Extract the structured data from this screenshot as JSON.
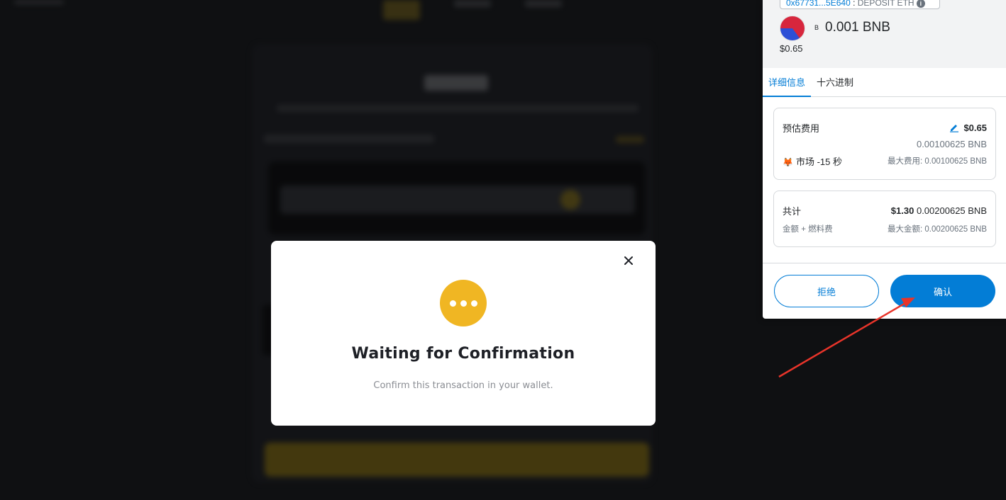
{
  "modal": {
    "title": "Waiting for Confirmation",
    "description": "Confirm this transaction in your wallet."
  },
  "wallet": {
    "origin": {
      "address": "0x67731...5E640",
      "separator": " : ",
      "label": "DEPOSIT ETH"
    },
    "token_symbol": "B",
    "amount": "0.001 BNB",
    "fiat": "$0.65",
    "tabs": [
      {
        "label": "详细信息",
        "active": true
      },
      {
        "label": "十六进制",
        "active": false
      }
    ],
    "fee": {
      "label": "预估费用",
      "fiat": "$0.65",
      "amount": "0.00100625 BNB",
      "speed": "市场",
      "time": "-15 秒",
      "max_label": "最大费用:",
      "max_value": "0.00100625 BNB"
    },
    "total": {
      "label": "共计",
      "fiat": "$1.30",
      "amount": "0.00200625 BNB",
      "sub_label": "金额 + 燃料费",
      "max_label": "最大金额:",
      "max_value": "0.00200625 BNB"
    },
    "buttons": {
      "reject": "拒绝",
      "confirm": "确认"
    }
  },
  "colors": {
    "accent_blue": "#037dd6",
    "pending_yellow": "#f0b623",
    "annotation_red": "#e8342a"
  },
  "icons": [
    "close-icon",
    "more-dots-icon",
    "info-icon",
    "edit-icon",
    "fox-icon",
    "account-avatar-icon",
    "red-arrow-annotation"
  ]
}
